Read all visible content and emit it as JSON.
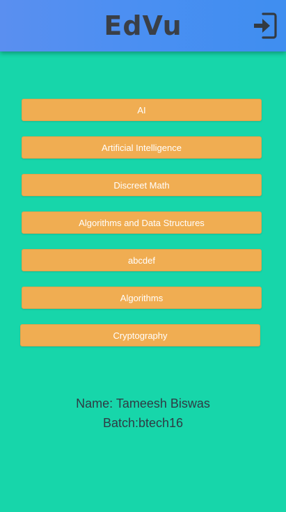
{
  "header": {
    "title": "EdVu",
    "logout_icon": "logout-icon"
  },
  "courses": [
    {
      "label": "AI"
    },
    {
      "label": "Artificial Intelligence"
    },
    {
      "label": "Discreet Math"
    },
    {
      "label": "Algorithms and Data Structures"
    },
    {
      "label": "abcdef"
    },
    {
      "label": "Algorithms"
    },
    {
      "label": "Cryptography"
    }
  ],
  "user": {
    "name_line": "Name: Tameesh Biswas",
    "batch_line": "Batch:btech16"
  },
  "colors": {
    "background": "#17d6aa",
    "app_bar": "#4a8ff2",
    "button": "#f0ad52",
    "title_text": "#3a3f47"
  }
}
